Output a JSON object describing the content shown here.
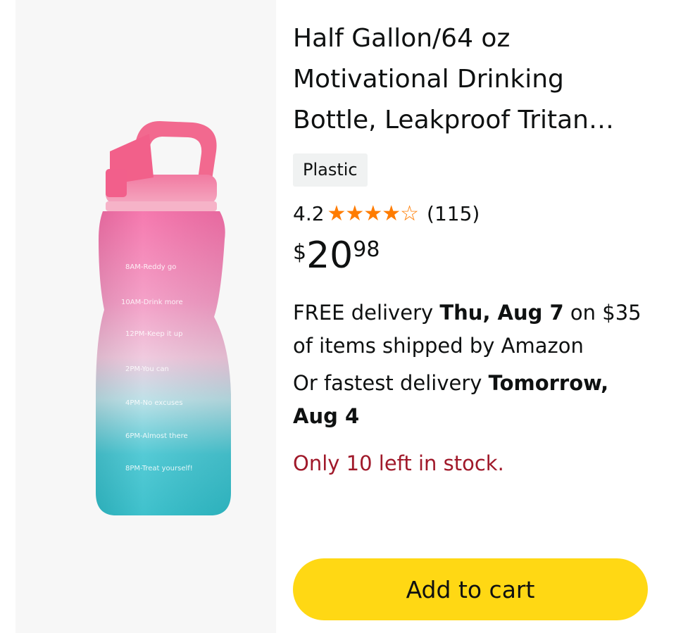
{
  "product": {
    "title": "Half Gallon/64 oz Motivational Drinking Bottle, Leakproof Tritan…",
    "material_badge": "Plastic",
    "rating": {
      "value": "4.2",
      "stars_text": "★★★★☆",
      "stars_filled": 4,
      "stars_total": 5,
      "count": "(115)",
      "star_color": "#ff7c00"
    },
    "price": {
      "symbol": "$",
      "whole": "20",
      "fraction": "98"
    },
    "delivery": {
      "prefix": "FREE delivery ",
      "date": "Thu, Aug 7",
      "suffix": " on $35 of items shipped by Amazon"
    },
    "fastest": {
      "prefix": "Or fastest delivery ",
      "date": "Tomorrow, Aug 4"
    },
    "stock": "Only 10 left in stock.",
    "add_to_cart": "Add to cart",
    "image": {
      "markers": [
        "8AM-Reddy go",
        "10AM-Drink more",
        "12PM-Keep it up",
        "2PM-You can",
        "4PM-No excuses",
        "6PM-Almost there",
        "8PM-Treat yourself!"
      ]
    }
  },
  "colors": {
    "button": "#ffd814",
    "stock_text": "#a0192a",
    "badge_bg": "#f0f2f2"
  }
}
